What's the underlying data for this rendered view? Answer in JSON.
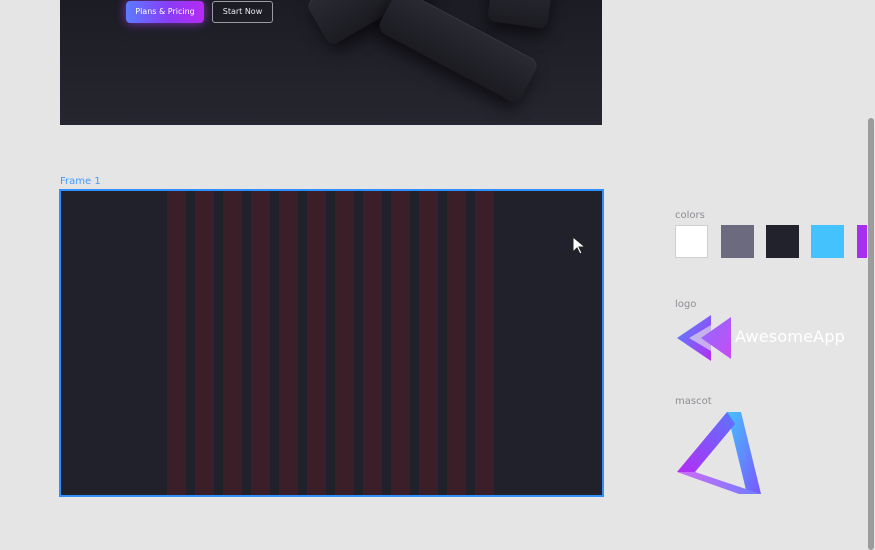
{
  "hero": {
    "primary_button": "Plans & Pricing",
    "secondary_button": "Start Now"
  },
  "frame": {
    "label": "Frame 1",
    "column_count": 12
  },
  "panel": {
    "colors_label": "colors",
    "colors": [
      "#ffffff",
      "#6b6a7f",
      "#22222c",
      "#44c2fd",
      "#a62ff0"
    ],
    "logo_label": "logo",
    "logo_text": "AwesomeApp",
    "mascot_label": "mascot"
  },
  "icons": {
    "cursor": "arrow-cursor-icon",
    "logo": "double-triangle-logo-icon",
    "mascot": "impossible-triangle-icon"
  }
}
